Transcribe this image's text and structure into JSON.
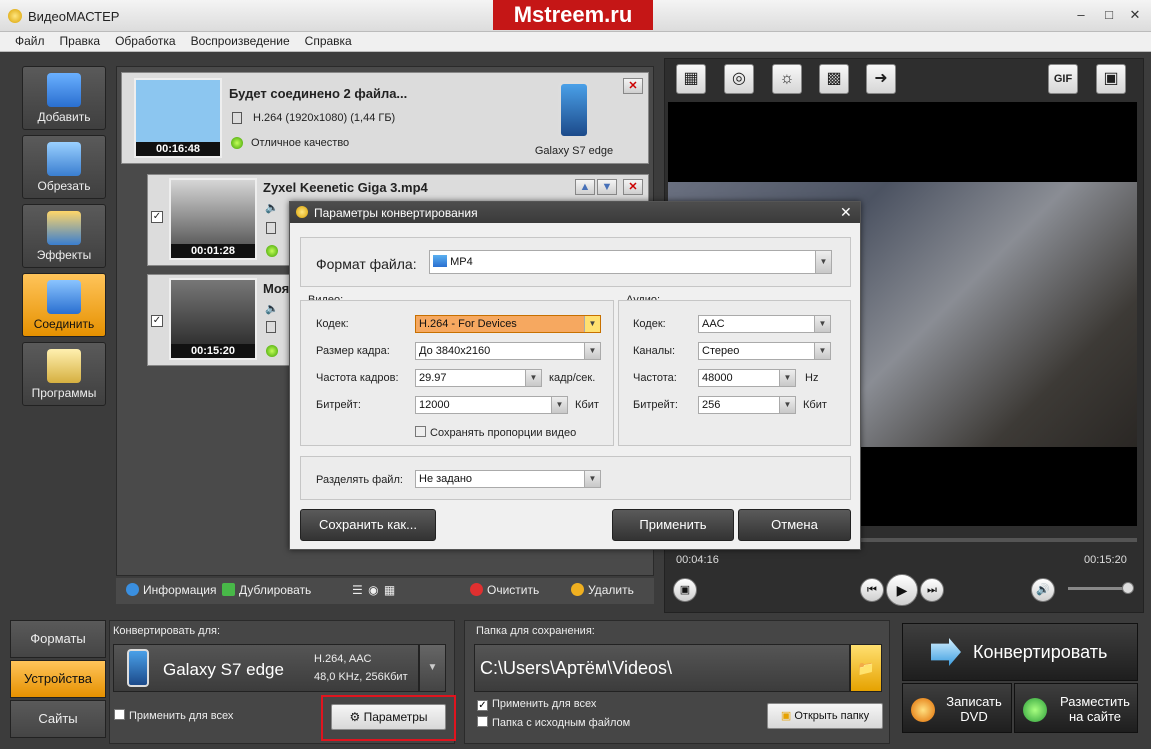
{
  "app": {
    "title": "ВидеоМАСТЕР",
    "watermark": "Mstreem.ru"
  },
  "menu": [
    "Файл",
    "Правка",
    "Обработка",
    "Воспроизведение",
    "Справка"
  ],
  "left_toolbar": [
    "Добавить",
    "Обрезать",
    "Эффекты",
    "Соединить",
    "Программы"
  ],
  "merge_item": {
    "title": "Будет соединено 2 файла...",
    "codec_info": "H.264 (1920x1080) (1,44 ГБ)",
    "quality": "Отличное качество",
    "duration": "00:16:48",
    "device": "Galaxy S7 edge"
  },
  "files": [
    {
      "title": "Zyxel Keenetic Giga 3.mp4",
      "duration": "00:01:28"
    },
    {
      "title": "Моя",
      "duration": "00:15:20"
    }
  ],
  "list_toolbar": {
    "info": "Информация",
    "duplicate": "Дублировать",
    "clear": "Очистить",
    "delete": "Удалить"
  },
  "player": {
    "current_time": "00:04:16",
    "total_time": "00:15:20",
    "gif_label": "GIF"
  },
  "bottom": {
    "tabs": [
      "Форматы",
      "Устройства",
      "Сайты"
    ],
    "convert_for_label": "Конвертировать для:",
    "device_name": "Galaxy S7 edge",
    "device_spec1": "H.264, AAC",
    "device_spec2": "48,0 KHz, 256Кбит",
    "apply_all": "Применить для всех",
    "params_button": "Параметры",
    "save_folder_label": "Папка для сохранения:",
    "save_path": "C:\\Users\\Артём\\Videos\\",
    "apply_all2": "Применить для всех",
    "source_folder": "Папка с исходным файлом",
    "open_folder": "Открыть папку",
    "convert_button": "Конвертировать",
    "burn_dvd": "Записать DVD",
    "publish": "Разместить на сайте"
  },
  "dialog": {
    "title": "Параметры конвертирования",
    "format_label": "Формат файла:",
    "format_value": "MP4",
    "video_group": "Видео:",
    "audio_group": "Аудио:",
    "video": {
      "codec_label": "Кодек:",
      "codec_value": "H.264 - For Devices",
      "size_label": "Размер кадра:",
      "size_value": "До 3840x2160",
      "fps_label": "Частота кадров:",
      "fps_value": "29.97",
      "fps_unit": "кадр/сек.",
      "bitrate_label": "Битрейт:",
      "bitrate_value": "12000",
      "bitrate_unit": "Кбит",
      "keep_ratio": "Сохранять пропорции видео"
    },
    "audio": {
      "codec_label": "Кодек:",
      "codec_value": "AAC",
      "channels_label": "Каналы:",
      "channels_value": "Стерео",
      "freq_label": "Частота:",
      "freq_value": "48000",
      "freq_unit": "Hz",
      "bitrate_label": "Битрейт:",
      "bitrate_value": "256",
      "bitrate_unit": "Кбит"
    },
    "split_label": "Разделять файл:",
    "split_value": "Не задано",
    "save_as": "Сохранить как...",
    "apply": "Применить",
    "cancel": "Отмена"
  },
  "colors": {
    "accent": "#f0a020",
    "highlight_red": "#e0141e"
  }
}
